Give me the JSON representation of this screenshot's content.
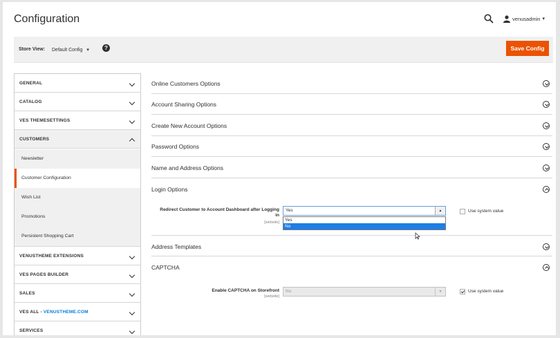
{
  "header": {
    "title": "Configuration",
    "user_name": "venusadmin",
    "caret": "▾"
  },
  "scope": {
    "store_view_label": "Store View:",
    "store_view_value": "Default Config",
    "store_view_caret": "▾",
    "help": "?",
    "save_label": "Save Config"
  },
  "sidebar": {
    "tabs_top": [
      {
        "label": "GENERAL"
      },
      {
        "label": "CATALOG"
      },
      {
        "label": "VES THEMESETTINGS"
      }
    ],
    "customers": {
      "label": "CUSTOMERS",
      "items": [
        {
          "label": "Newsletter"
        },
        {
          "label": "Customer Configuration"
        },
        {
          "label": "Wish List"
        },
        {
          "label": "Promotions"
        },
        {
          "label": "Persistent Shopping Cart"
        }
      ]
    },
    "tabs_bottom": [
      {
        "label": "VENUSTHEME EXTENSIONS"
      },
      {
        "label": "VES PAGES BUILDER"
      },
      {
        "label": "SALES"
      }
    ],
    "ves_all": {
      "prefix": "VES ALL - ",
      "accent": "VENUSTHEME.COM"
    },
    "partial_tab": "SERVICES"
  },
  "sections": [
    {
      "title": "Online Customers Options"
    },
    {
      "title": "Account Sharing Options"
    },
    {
      "title": "Create New Account Options"
    },
    {
      "title": "Password Options"
    },
    {
      "title": "Name and Address Options"
    },
    {
      "title": "Login Options"
    },
    {
      "title": "Address Templates"
    },
    {
      "title": "CAPTCHA"
    }
  ],
  "login_field": {
    "label_line1": "Redirect Customer to Account Dashboard after Logging",
    "label_line2": "in",
    "scope": "[website]",
    "value": "Yes",
    "btn": "▲",
    "options": [
      "Yes",
      "No"
    ],
    "use_system_value": "Use system value",
    "use_system_checked": false
  },
  "captcha_field": {
    "label": "Enable CAPTCHA on Storefront",
    "scope": "[website]",
    "value": "No",
    "btn": "▼",
    "use_system_value": "Use system value",
    "use_system_checked": true
  },
  "colors": {
    "accent": "#eb5202",
    "link": "#007bdb",
    "selected_option": "#1e7ee6"
  }
}
